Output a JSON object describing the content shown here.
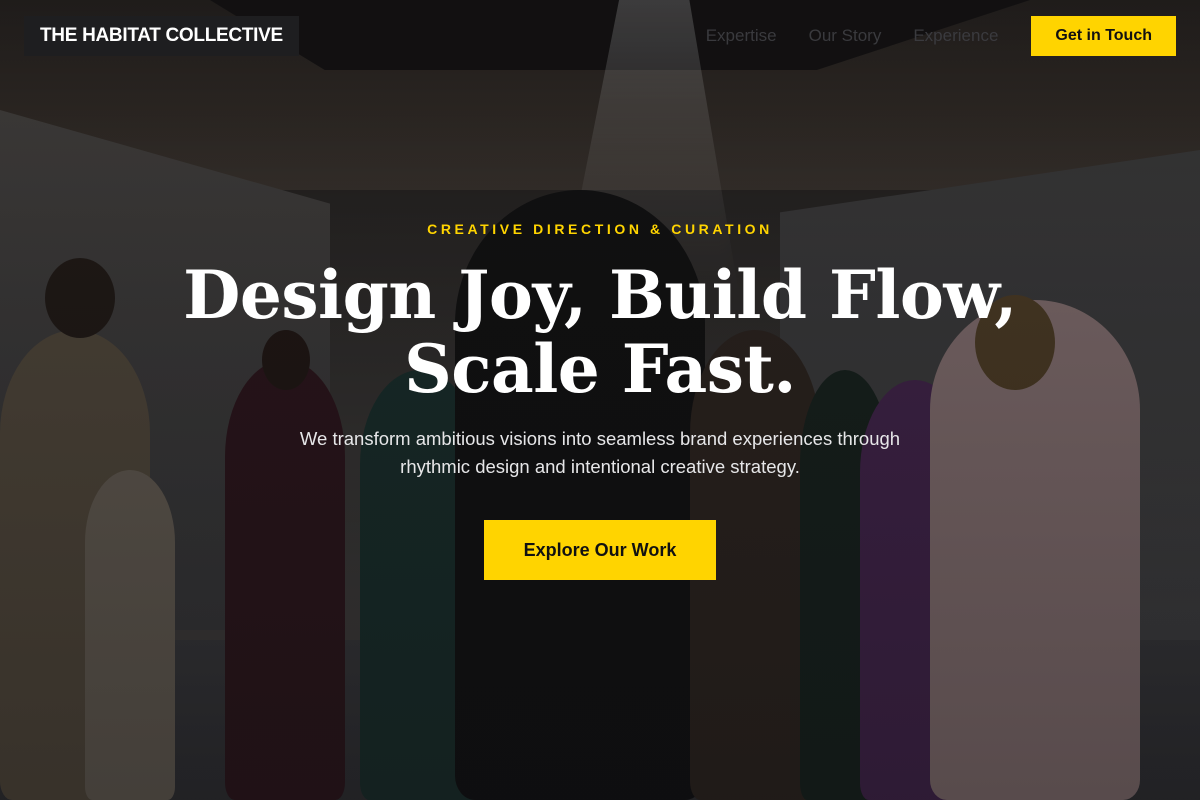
{
  "nav": {
    "logo": "THE HABITAT COLLECTIVE",
    "links": [
      "Expertise",
      "Our Story",
      "Experience"
    ],
    "cta": "Get in Touch"
  },
  "hero": {
    "eyebrow": "CREATIVE DIRECTION & CURATION",
    "headline_line1": "Design Joy, Build Flow,",
    "headline_line2": "Scale Fast.",
    "subtext": "We transform ambitious visions into seamless brand experiences through rhythmic design and intentional creative strategy.",
    "cta": "Explore Our Work"
  },
  "colors": {
    "accent": "#ffd400",
    "logo_background": "#1e1e20",
    "headline": "#ffffff"
  }
}
